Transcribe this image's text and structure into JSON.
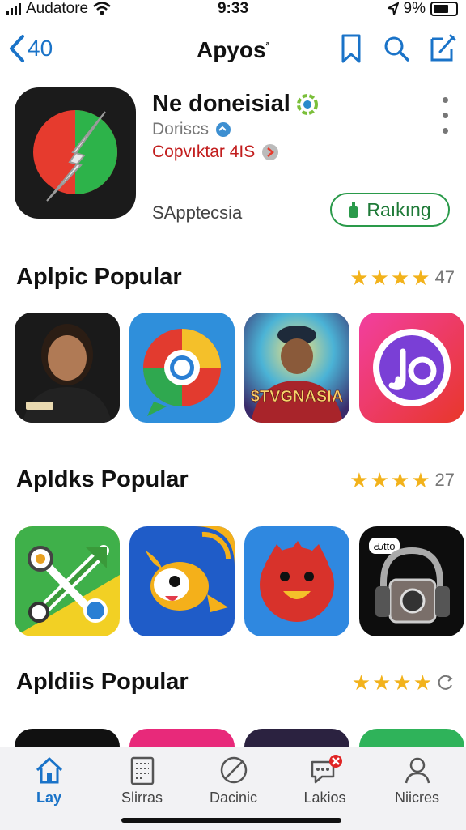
{
  "status_bar": {
    "carrier": "Audatore",
    "time": "9:33",
    "battery": "9%"
  },
  "navbar": {
    "back_label": "40",
    "title": "Apyos",
    "title_mark": "ª"
  },
  "app": {
    "name": "Ne doneisial",
    "developer": "Dorisсs",
    "subtitle": "Copvıktar 4IS",
    "category": "SApptecsia",
    "rank_button": "Raıkıng"
  },
  "sections": [
    {
      "title": "Aplpic Popular",
      "rating_count": "47",
      "tile_caption": "$TVGNASIA"
    },
    {
      "title": "Apldks Popular",
      "rating_count": "27",
      "tile_caption": "Ԃtto"
    },
    {
      "title": "Apldiis Popular",
      "rating_count": ""
    }
  ],
  "tabs": [
    {
      "label": "Lay",
      "icon": "home-icon"
    },
    {
      "label": "Slirras",
      "icon": "list-icon"
    },
    {
      "label": "Dacinic",
      "icon": "circle-slash-icon"
    },
    {
      "label": "Lakios",
      "icon": "chat-badge-icon"
    },
    {
      "label": "Niicres",
      "icon": "person-icon"
    }
  ],
  "colors": {
    "accent": "#1a73c8",
    "star": "#f2b21b",
    "rank_green": "#2a9a4a",
    "subtitle_red": "#c21e1e"
  }
}
